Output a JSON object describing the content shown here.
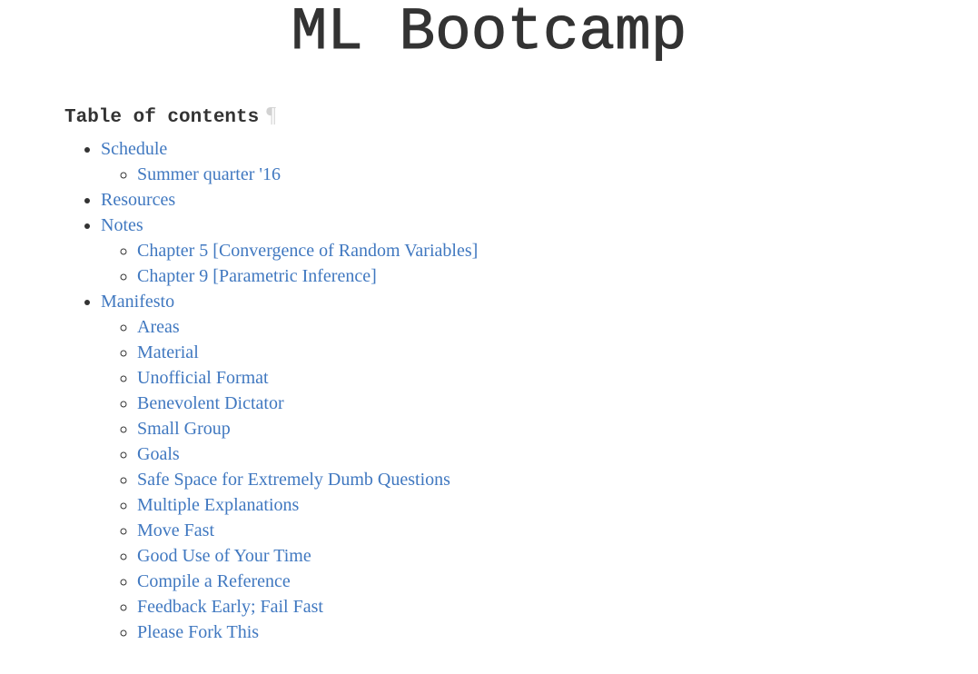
{
  "page_title": "ML Bootcamp",
  "toc": {
    "heading": "Table of contents",
    "anchor_symbol": "¶",
    "link_color": "#4078c0",
    "items": [
      {
        "label": "Schedule",
        "children": [
          {
            "label": "Summer quarter '16"
          }
        ]
      },
      {
        "label": "Resources",
        "children": []
      },
      {
        "label": "Notes",
        "children": [
          {
            "label": "Chapter 5 [Convergence of Random Variables]"
          },
          {
            "label": "Chapter 9 [Parametric Inference]"
          }
        ]
      },
      {
        "label": "Manifesto",
        "children": [
          {
            "label": "Areas"
          },
          {
            "label": "Material"
          },
          {
            "label": "Unofficial Format"
          },
          {
            "label": "Benevolent Dictator"
          },
          {
            "label": "Small Group"
          },
          {
            "label": "Goals"
          },
          {
            "label": "Safe Space for Extremely Dumb Questions"
          },
          {
            "label": "Multiple Explanations"
          },
          {
            "label": "Move Fast"
          },
          {
            "label": "Good Use of Your Time"
          },
          {
            "label": "Compile a Reference"
          },
          {
            "label": "Feedback Early; Fail Fast"
          },
          {
            "label": "Please Fork This"
          }
        ]
      }
    ]
  }
}
